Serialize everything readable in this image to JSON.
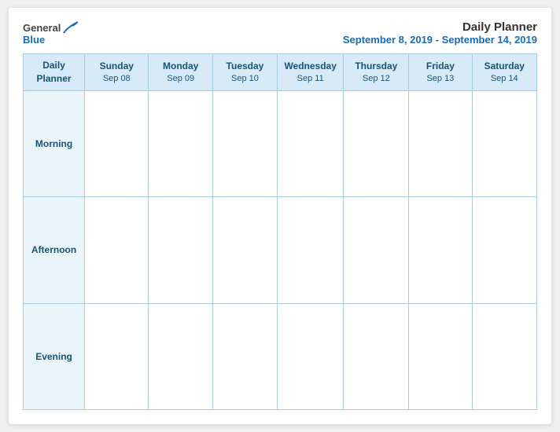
{
  "logo": {
    "general": "General",
    "blue": "Blue"
  },
  "header": {
    "title": "Daily Planner",
    "subtitle": "September 8, 2019 - September 14, 2019"
  },
  "table": {
    "label_header": "Daily Planner",
    "days": [
      {
        "name": "Sunday",
        "date": "Sep 08"
      },
      {
        "name": "Monday",
        "date": "Sep 09"
      },
      {
        "name": "Tuesday",
        "date": "Sep 10"
      },
      {
        "name": "Wednesday",
        "date": "Sep 11"
      },
      {
        "name": "Thursday",
        "date": "Sep 12"
      },
      {
        "name": "Friday",
        "date": "Sep 13"
      },
      {
        "name": "Saturday",
        "date": "Sep 14"
      }
    ],
    "rows": [
      {
        "label": "Morning"
      },
      {
        "label": "Afternoon"
      },
      {
        "label": "Evening"
      }
    ]
  }
}
